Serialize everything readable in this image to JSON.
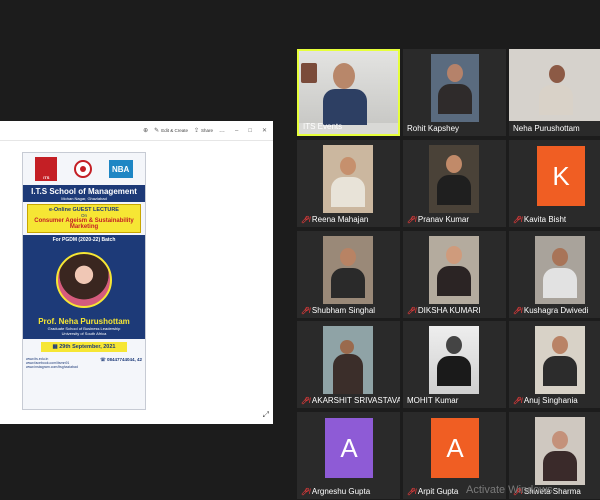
{
  "viewer": {
    "toolbar": {
      "edit_create": "Edit & Create",
      "share": "Share"
    }
  },
  "poster": {
    "school_name": "I.T.S School of Management",
    "location": "Mohan Nagar, Ghaziabad",
    "lecture_line1": "e-Online GUEST LECTURE",
    "lecture_on": "On",
    "lecture_topic": "Consumer Ageism & Sustainability Marketing",
    "batch": "For PGDM (2020-22) Batch",
    "speaker_name": "Prof. Neha Purushottam",
    "speaker_affiliation1": "Graduate School of Business Leadership",
    "speaker_affiliation2": "University of South Africa",
    "date": "29th September, 2021",
    "contact_lines": [
      "www.its.edu.in",
      "www.facebook.com/itsmn91",
      "www.instagram.com/itsghaziabad"
    ],
    "phone": "08447744044, 42",
    "logo_text_1": "ITS",
    "logo_text_3": "NBA"
  },
  "participants": [
    {
      "name": "ITS Events",
      "muted": false,
      "video": true,
      "active": true
    },
    {
      "name": "Rohit Kapshey",
      "muted": false,
      "video": true
    },
    {
      "name": "Neha Purushottam",
      "muted": false,
      "video": true
    },
    {
      "name": "Reena Mahajan",
      "muted": true,
      "video": true
    },
    {
      "name": "Pranav Kumar",
      "muted": true,
      "video": true
    },
    {
      "name": "Kavita Bisht",
      "muted": true,
      "video": false,
      "initial": "K",
      "color": "#f05e23"
    },
    {
      "name": "Shubham Singhal",
      "muted": true,
      "video": true
    },
    {
      "name": "DIKSHA KUMARI",
      "muted": true,
      "video": true
    },
    {
      "name": "Kushagra Dwivedi",
      "muted": true,
      "video": true
    },
    {
      "name": "AKARSHIT SRIVASTAVA",
      "muted": true,
      "video": true
    },
    {
      "name": "MOHIT Kumar",
      "muted": false,
      "video": true
    },
    {
      "name": "Anuj Singhania",
      "muted": true,
      "video": true
    },
    {
      "name": "Argneshu Gupta",
      "muted": true,
      "video": false,
      "initial": "A",
      "color": "#8e5bd6"
    },
    {
      "name": "Arpit Gupta",
      "muted": true,
      "video": false,
      "initial": "A",
      "color": "#f05e23"
    },
    {
      "name": "Shweta Sharma",
      "muted": true,
      "video": true
    }
  ],
  "watermark": "Activate Windows",
  "colors": {
    "background": "#1c1c1c",
    "active_speaker_border": "#e6ff3b",
    "mute": "#e23a3a",
    "poster_navy": "#1d3a78",
    "poster_yellow": "#f6e634"
  }
}
